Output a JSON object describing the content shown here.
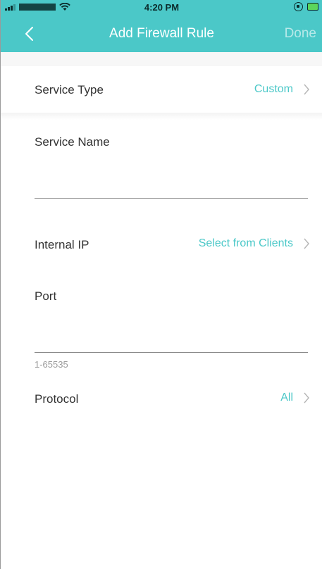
{
  "status_bar": {
    "time": "4:20 PM"
  },
  "nav": {
    "title": "Add Firewall Rule",
    "done_label": "Done",
    "back_icon": "chevron-left-icon"
  },
  "colors": {
    "accent": "#4bc8c8",
    "label": "#333333",
    "hint": "#9a9a9a"
  },
  "form": {
    "service_type": {
      "label": "Service Type",
      "value": "Custom"
    },
    "service_name": {
      "label": "Service Name",
      "value": ""
    },
    "internal_ip": {
      "label": "Internal IP",
      "value": "Select from Clients"
    },
    "port": {
      "label": "Port",
      "value": "",
      "hint": "1-65535"
    },
    "protocol": {
      "label": "Protocol",
      "value": "All"
    }
  }
}
